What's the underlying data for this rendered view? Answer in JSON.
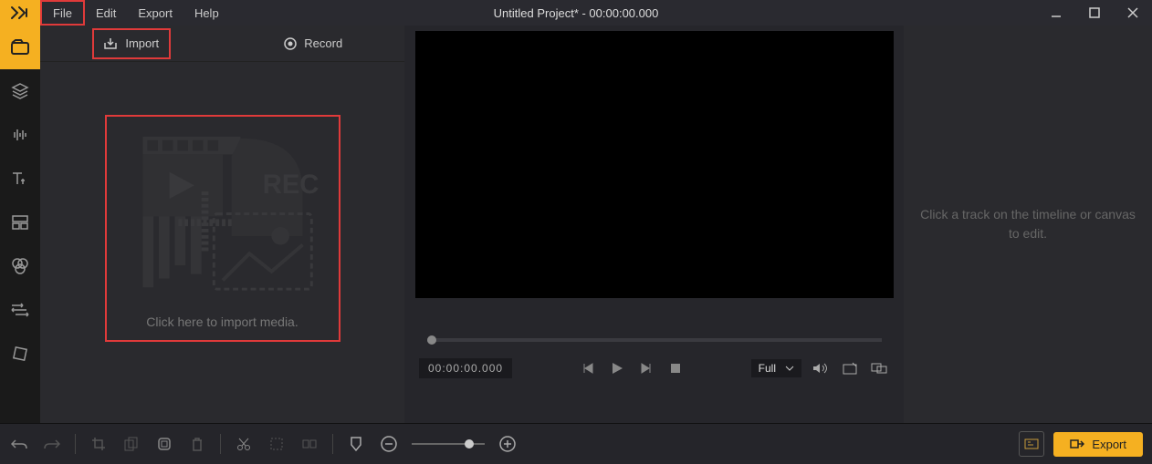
{
  "title": "Untitled Project* - 00:00:00.000",
  "menu": {
    "file": "File",
    "edit": "Edit",
    "export": "Export",
    "help": "Help"
  },
  "tabs": {
    "import": "Import",
    "record": "Record"
  },
  "dropzone": {
    "text": "Click here to import media."
  },
  "preview": {
    "timecode": "00:00:00.000",
    "fit": "Full"
  },
  "side": {
    "hint": "Click a track on the timeline or canvas to edit."
  },
  "bottom": {
    "export": "Export"
  }
}
